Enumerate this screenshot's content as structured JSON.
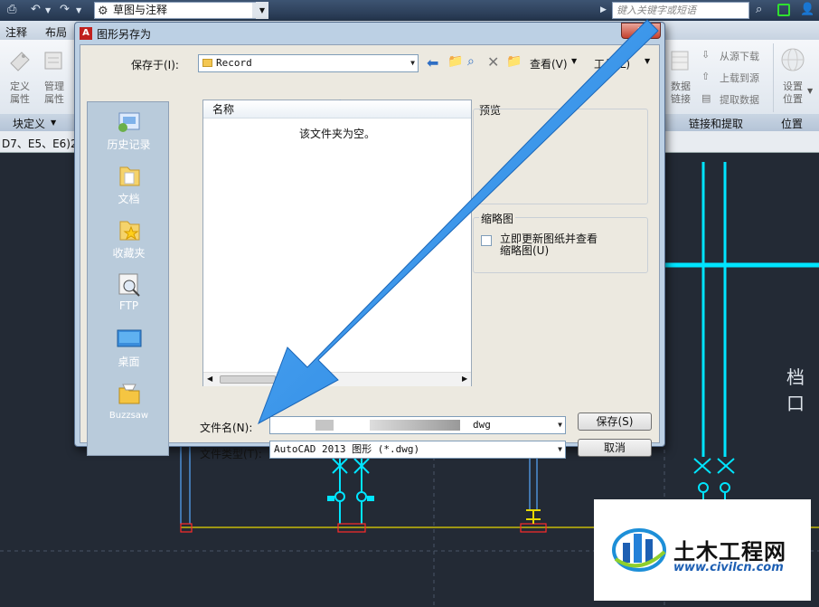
{
  "app": {
    "workspace": "草图与注释",
    "search_placeholder": "键入关键字或短语",
    "tabs": [
      "注释",
      "布局"
    ],
    "ribbon_left": {
      "define_attr": "定义\n属性",
      "manage_attr": "管理\n属性",
      "group": "块定义"
    },
    "ribbon_right": {
      "data_link": "数据\n链接",
      "download_src": "从源下载",
      "upload_src": "上载到源",
      "extract_data": "提取数据",
      "group": "链接和提取",
      "location": "设置\n位置",
      "location_group": "位置"
    },
    "file_tab": "D7、E5、E6)2",
    "drawing_label": "档口"
  },
  "dialog": {
    "title": "图形另存为",
    "save_in_label": "保存于(I):",
    "save_in_value": "Record",
    "toolbar": {
      "view": "查看(V)",
      "tools": "工具(L)"
    },
    "places": [
      {
        "label": "历史记录",
        "icon": "history-icon"
      },
      {
        "label": "文档",
        "icon": "documents-folder-icon"
      },
      {
        "label": "收藏夹",
        "icon": "favorites-folder-icon"
      },
      {
        "label": "FTP",
        "icon": "ftp-icon"
      },
      {
        "label": "桌面",
        "icon": "desktop-icon"
      },
      {
        "label": "Buzzsaw",
        "icon": "buzzsaw-icon"
      }
    ],
    "list_header": "名称",
    "list_empty": "该文件夹为空。",
    "preview_label": "预览",
    "thumbnail_label": "缩略图",
    "thumbnail_checkbox": "立即更新图纸并查看\n缩略图(U)",
    "filename_label": "文件名(N):",
    "filename_value": "dwg",
    "filetype_label": "文件类型(T):",
    "filetype_value": "AutoCAD 2013 图形 (*.dwg)",
    "save_button": "保存(S)",
    "cancel_button": "取消"
  },
  "watermark": {
    "brand": "土木工程网",
    "url": "www.civilcn.com"
  },
  "colors": {
    "arrow": "#2a8ae6",
    "cad_cyan": "#00e5ff",
    "cad_bg": "#232a35",
    "cad_yellow": "#e6d800",
    "cad_red": "#ff2a2a"
  }
}
